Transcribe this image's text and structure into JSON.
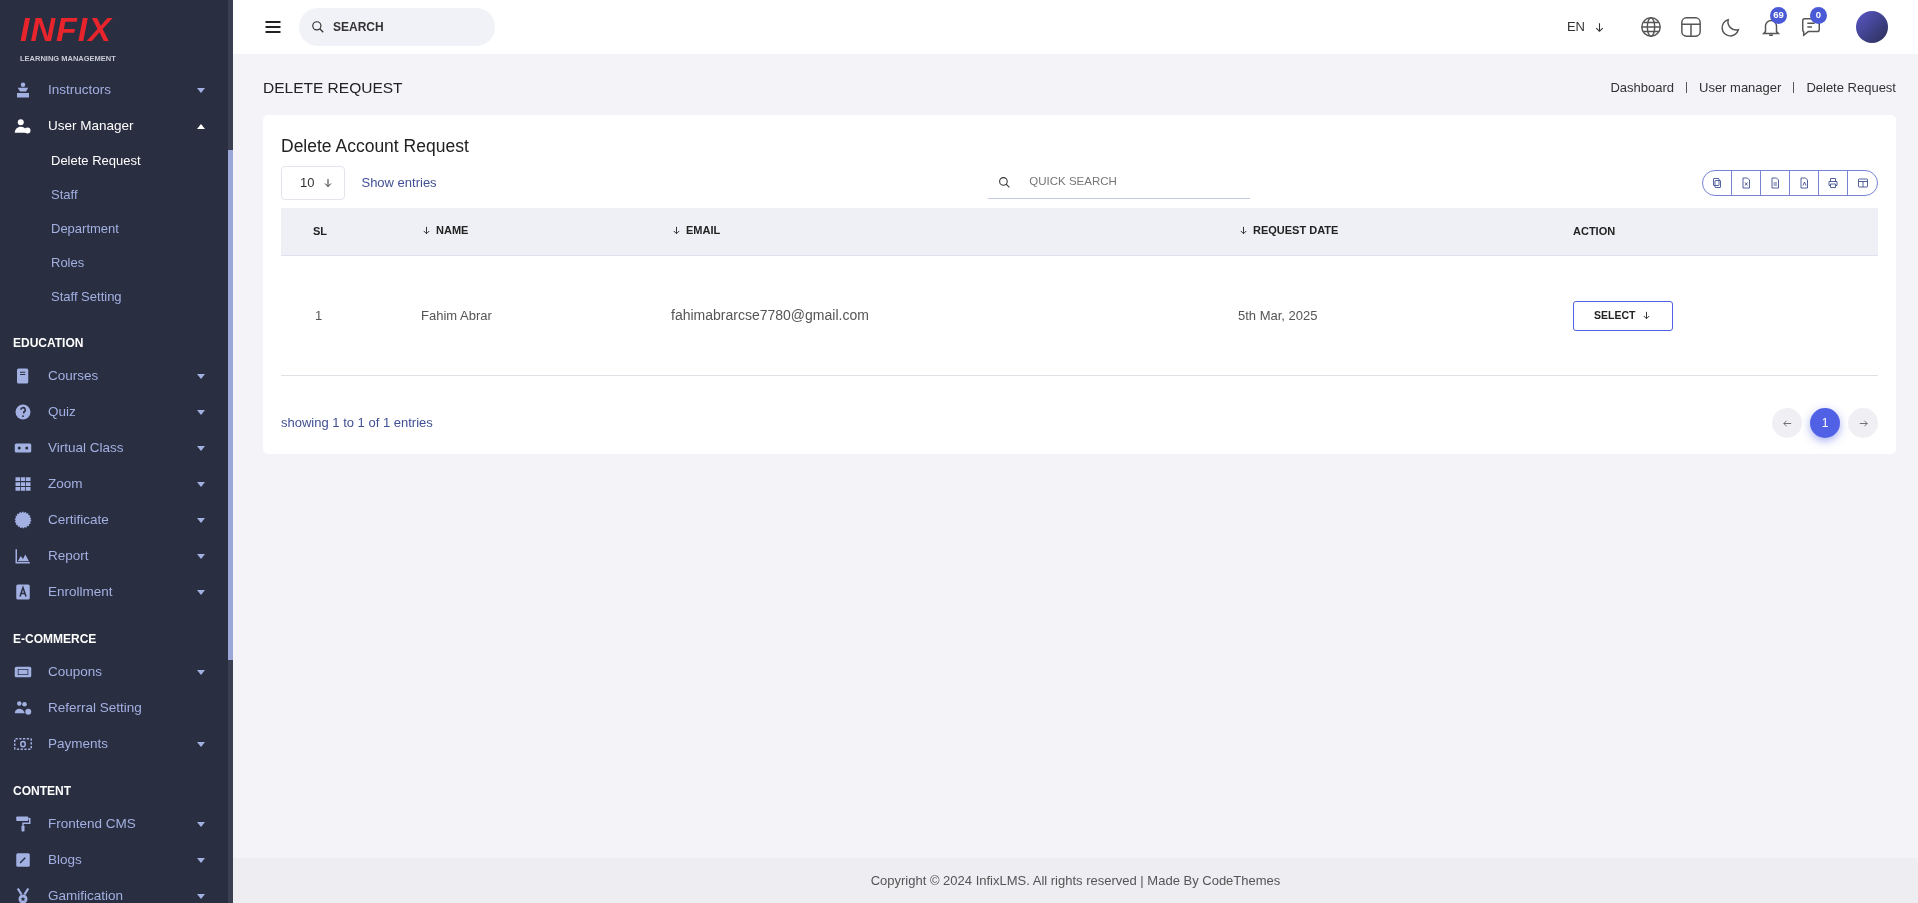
{
  "sidebar": {
    "logo": {
      "wordmark": "INFIX",
      "tagline": "LEARNING MANAGEMENT"
    },
    "items": [
      {
        "kind": "menu",
        "label": "Instructors",
        "expanded": false
      },
      {
        "kind": "menu",
        "label": "User Manager",
        "expanded": true,
        "children": [
          {
            "label": "Delete Request",
            "selected": true
          },
          {
            "label": "Staff",
            "selected": false
          },
          {
            "label": "Department",
            "selected": false
          },
          {
            "label": "Roles",
            "selected": false
          },
          {
            "label": "Staff Setting",
            "selected": false
          }
        ]
      },
      {
        "kind": "section",
        "label": "EDUCATION"
      },
      {
        "kind": "menu",
        "label": "Courses",
        "expanded": false
      },
      {
        "kind": "menu",
        "label": "Quiz",
        "expanded": false
      },
      {
        "kind": "menu",
        "label": "Virtual Class",
        "expanded": false
      },
      {
        "kind": "menu",
        "label": "Zoom",
        "expanded": false
      },
      {
        "kind": "menu",
        "label": "Certificate",
        "expanded": false
      },
      {
        "kind": "menu",
        "label": "Report",
        "expanded": false
      },
      {
        "kind": "menu",
        "label": "Enrollment",
        "expanded": false
      },
      {
        "kind": "section",
        "label": "E-COMMERCE"
      },
      {
        "kind": "menu",
        "label": "Coupons",
        "expanded": false
      },
      {
        "kind": "menu",
        "label": "Referral Setting"
      },
      {
        "kind": "menu",
        "label": "Payments",
        "expanded": false
      },
      {
        "kind": "section",
        "label": "CONTENT"
      },
      {
        "kind": "menu",
        "label": "Frontend CMS",
        "expanded": false
      },
      {
        "kind": "menu",
        "label": "Blogs",
        "expanded": false
      },
      {
        "kind": "menu",
        "label": "Gamification",
        "expanded": false
      }
    ]
  },
  "topbar": {
    "search": {
      "placeholder": "SEARCH"
    },
    "language": "EN",
    "notifications": {
      "count": "69"
    },
    "messages": {
      "count": "0"
    }
  },
  "page": {
    "title": "DELETE REQUEST",
    "breadcrumb": [
      "Dashboard",
      "User manager",
      "Delete Request"
    ]
  },
  "card": {
    "title": "Delete Account Request",
    "entries": {
      "value": "10",
      "label": "Show entries"
    },
    "quick_search": {
      "placeholder": "QUICK SEARCH"
    },
    "table": {
      "columns": [
        {
          "label": "SL",
          "sortable": false
        },
        {
          "label": "NAME",
          "sortable": true
        },
        {
          "label": "EMAIL",
          "sortable": true
        },
        {
          "label": "REQUEST DATE",
          "sortable": true
        },
        {
          "label": "ACTION",
          "sortable": false
        }
      ],
      "rows": [
        {
          "sl": "1",
          "name": "Fahim Abrar",
          "email": "fahimabrarcse7780@gmail.com",
          "request_date": "5th Mar, 2025",
          "action": "SELECT"
        }
      ]
    },
    "info": "showing 1 to 1 of 1 entries",
    "pages": [
      {
        "label": "1",
        "selected": true
      }
    ]
  },
  "footer": "Copyright © 2024 InfixLMS. All rights reserved | Made By CodeThemes"
}
